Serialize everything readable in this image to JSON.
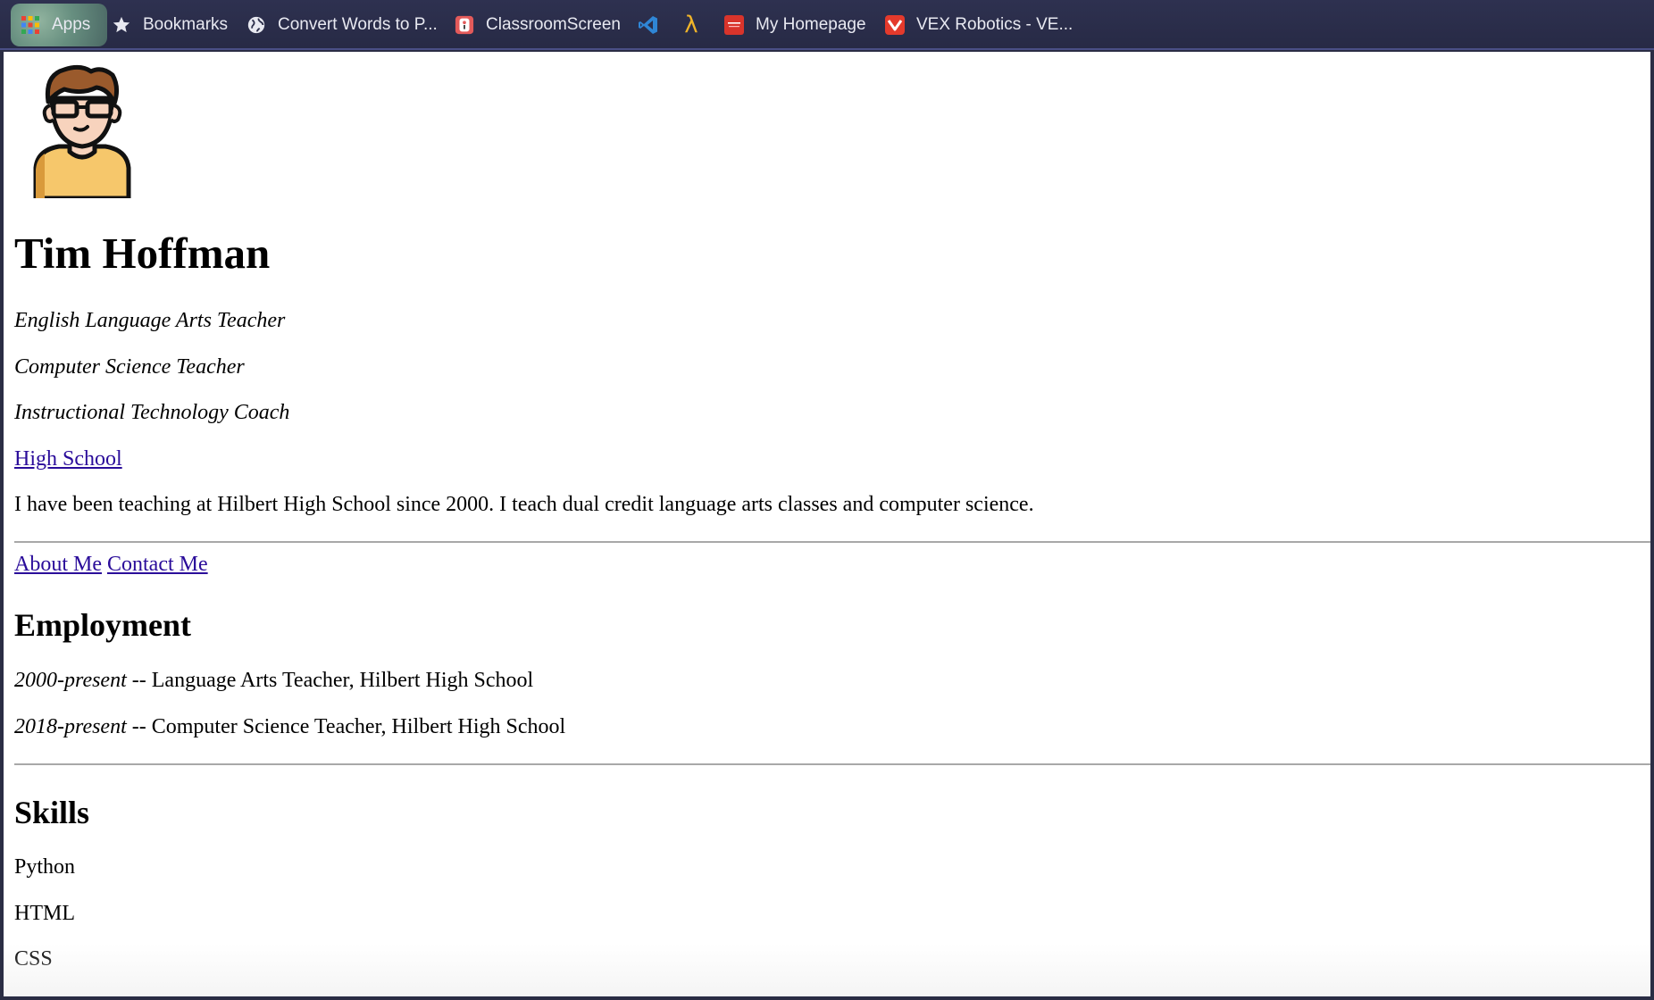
{
  "bookmarks_bar": {
    "items": [
      {
        "label": "Apps",
        "icon": "apps-grid-icon"
      },
      {
        "label": "Bookmarks",
        "icon": "star-icon"
      },
      {
        "label": "Convert Words to P...",
        "icon": "globe-icon"
      },
      {
        "label": "ClassroomScreen",
        "icon": "classroomscreen-icon"
      },
      {
        "label": "",
        "icon": "vscode-icon"
      },
      {
        "label": "",
        "icon": "lambda-icon"
      },
      {
        "label": "My Homepage",
        "icon": "oracle-icon"
      },
      {
        "label": "VEX Robotics - VE...",
        "icon": "vex-icon"
      }
    ],
    "lambda_glyph": "λ"
  },
  "profile": {
    "avatar_icon": "avatar-man-glasses-icon",
    "name": "Tim Hoffman",
    "roles": [
      "English Language Arts Teacher",
      "Computer Science Teacher",
      "Instructional Technology Coach"
    ],
    "school_link": "High School",
    "bio": "I have been teaching at Hilbert High School since 2000. I teach dual credit language arts classes and computer science."
  },
  "nav": {
    "about": "About Me",
    "contact": "Contact Me"
  },
  "employment": {
    "heading": "Employment",
    "entries": [
      {
        "years": "2000-present",
        "sep": " -- ",
        "position": "Language Arts Teacher, Hilbert High School"
      },
      {
        "years": "2018-present",
        "sep": " -- ",
        "position": "Computer Science Teacher, Hilbert High School"
      }
    ]
  },
  "skills": {
    "heading": "Skills",
    "items": [
      "Python",
      "HTML",
      "CSS"
    ]
  },
  "colors": {
    "link": "#2a0c9a",
    "bookmarks_bar_bg": "#2b2e4a",
    "rule": "#a8a8a8"
  }
}
